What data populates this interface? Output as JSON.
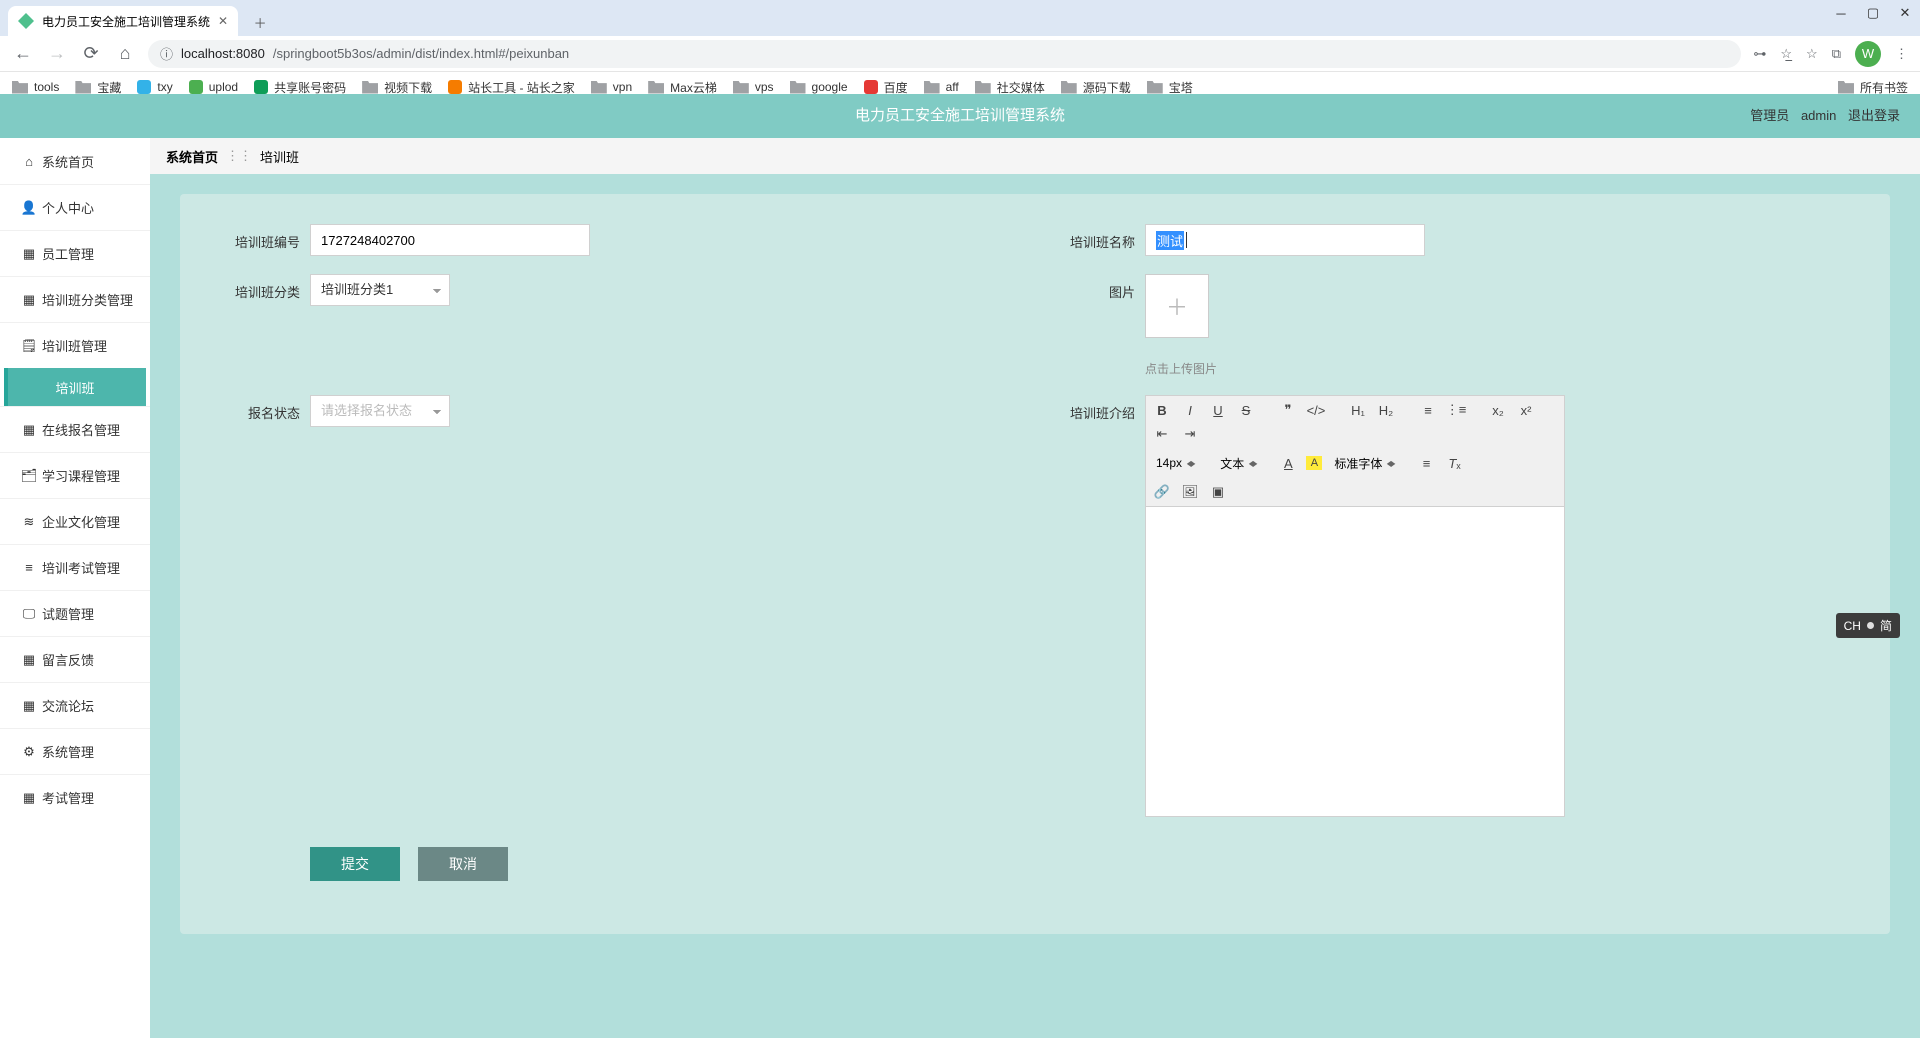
{
  "browser": {
    "tab_title": "电力员工安全施工培训管理系统",
    "url_host": "localhost:8080",
    "url_path": "/springboot5b3os/admin/dist/index.html#/peixunban",
    "avatar_letter": "W",
    "bookmarks": [
      "tools",
      "宝藏",
      "txy",
      "uplod",
      "共享账号密码",
      "视频下载",
      "站长工具 - 站长之家",
      "vpn",
      "Max云梯",
      "vps",
      "google",
      "百度",
      "aff",
      "社交媒体",
      "源码下载",
      "宝塔"
    ],
    "all_bookmarks_label": "所有书签"
  },
  "header": {
    "title": "电力员工安全施工培训管理系统",
    "role_label": "管理员",
    "user_name": "admin",
    "logout": "退出登录"
  },
  "sidebar": {
    "items": [
      {
        "icon": "home",
        "label": "系统首页"
      },
      {
        "icon": "user",
        "label": "个人中心"
      },
      {
        "icon": "grid",
        "label": "员工管理"
      },
      {
        "icon": "grid",
        "label": "培训班分类管理"
      },
      {
        "icon": "clipboard",
        "label": "培训班管理"
      },
      {
        "icon": "grid",
        "label": "在线报名管理"
      },
      {
        "icon": "book",
        "label": "学习课程管理"
      },
      {
        "icon": "culture",
        "label": "企业文化管理"
      },
      {
        "icon": "bars",
        "label": "培训考试管理"
      },
      {
        "icon": "monitor",
        "label": "试题管理"
      },
      {
        "icon": "grid",
        "label": "留言反馈"
      },
      {
        "icon": "grid",
        "label": "交流论坛"
      },
      {
        "icon": "gear",
        "label": "系统管理"
      },
      {
        "icon": "grid",
        "label": "考试管理"
      }
    ],
    "sub_active": "培训班"
  },
  "breadcrumb": {
    "home": "系统首页",
    "current": "培训班"
  },
  "form": {
    "code_label": "培训班编号",
    "code_value": "1727248402700",
    "name_label": "培训班名称",
    "name_value": "测试",
    "cat_label": "培训班分类",
    "cat_value": "培训班分类1",
    "img_label": "图片",
    "img_hint": "点击上传图片",
    "status_label": "报名状态",
    "status_placeholder": "请选择报名状态",
    "intro_label": "培训班介绍",
    "submit": "提交",
    "cancel": "取消"
  },
  "editor": {
    "fontsize": "14px",
    "style": "文本",
    "fontfamily": "标准字体"
  },
  "ime": {
    "lang": "CH",
    "mode": "简"
  }
}
